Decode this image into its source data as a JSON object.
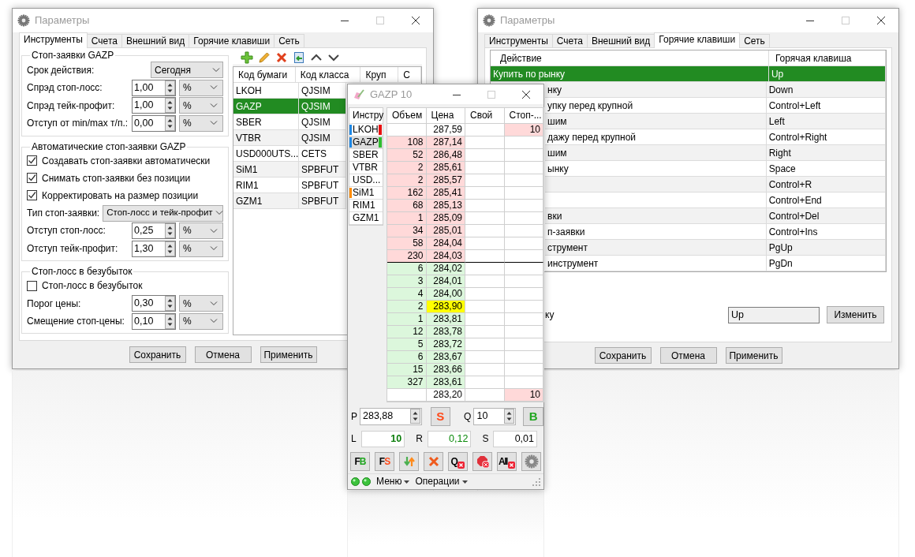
{
  "settings_window": {
    "title": "Параметры",
    "tabs": [
      {
        "label": "Инструменты",
        "selected": true
      },
      {
        "label": "Счета",
        "selected": false
      },
      {
        "label": "Внешний вид",
        "selected": false
      },
      {
        "label": "Горячие клавиши",
        "selected": false
      },
      {
        "label": "Сеть",
        "selected": false
      }
    ],
    "groups": [
      {
        "title": "Стоп-заявки GAZP",
        "rows": [
          {
            "kind": "select",
            "label": "Срок действия:",
            "value": "Сегодня"
          },
          {
            "kind": "spin",
            "label": "Спрэд стоп-лосс:",
            "value": "1,00",
            "unit": "%"
          },
          {
            "kind": "spin",
            "label": "Спрэд тейк-профит:",
            "value": "1,00",
            "unit": "%"
          },
          {
            "kind": "spin",
            "label": "Отступ от min/max т/п.:",
            "value": "0,00",
            "unit": "%"
          }
        ]
      },
      {
        "title": "Автоматические стоп-заявки GAZP",
        "rows": [
          {
            "kind": "check",
            "label": "Создавать стоп-заявки автоматически",
            "checked": true
          },
          {
            "kind": "check",
            "label": "Снимать стоп-заявки без позиции",
            "checked": true
          },
          {
            "kind": "check",
            "label": "Корректировать на размер позиции",
            "checked": true
          },
          {
            "kind": "select",
            "label": "Тип стоп-заявки:",
            "value": "Стоп-лосс и тейк-профит"
          },
          {
            "kind": "spin",
            "label": "Отступ стоп-лосс:",
            "value": "0,25",
            "unit": "%"
          },
          {
            "kind": "spin",
            "label": "Отступ тейк-профит:",
            "value": "1,30",
            "unit": "%"
          }
        ]
      },
      {
        "title": "Стоп-лосс в безубыток",
        "rows": [
          {
            "kind": "check",
            "label": "Стоп-лосс в безубыток",
            "checked": false
          },
          {
            "kind": "spin",
            "label": "Порог цены:",
            "value": "0,30",
            "unit": "%"
          },
          {
            "kind": "spin",
            "label": "Смещение стоп-цены:",
            "value": "0,10",
            "unit": "%"
          }
        ]
      }
    ],
    "table": {
      "columns": [
        "Код бумаги",
        "Код класса",
        "Круп",
        "С"
      ],
      "rows": [
        {
          "cells": [
            "LKOH",
            "QJSIM"
          ],
          "selected": false
        },
        {
          "cells": [
            "GAZP",
            "QJSIM"
          ],
          "selected": true
        },
        {
          "cells": [
            "SBER",
            "QJSIM"
          ],
          "selected": false
        },
        {
          "cells": [
            "VTBR",
            "QJSIM"
          ],
          "selected": false
        },
        {
          "cells": [
            "USD000UTS...",
            "CETS"
          ],
          "selected": false
        },
        {
          "cells": [
            "SiM1",
            "SPBFUT"
          ],
          "selected": false
        },
        {
          "cells": [
            "RIM1",
            "SPBFUT"
          ],
          "selected": false
        },
        {
          "cells": [
            "GZM1",
            "SPBFUT"
          ],
          "selected": false
        }
      ]
    },
    "buttons": [
      "Сохранить",
      "Отмена",
      "Применить"
    ]
  },
  "hotkeys_window": {
    "title": "Параметры",
    "tabs": [
      {
        "label": "Инструменты",
        "selected": false
      },
      {
        "label": "Счета",
        "selected": false
      },
      {
        "label": "Внешний вид",
        "selected": false
      },
      {
        "label": "Горячие клавиши",
        "selected": true
      },
      {
        "label": "Сеть",
        "selected": false
      }
    ],
    "table": {
      "columns": [
        "Действие",
        "Горячая клавиша"
      ],
      "rows": [
        {
          "action": "Купить по рынку",
          "key": "Up",
          "selected": true
        },
        {
          "action": "нку",
          "key": "Down",
          "selected": false
        },
        {
          "action": "упку перед крупной",
          "key": "Control+Left",
          "selected": false
        },
        {
          "action": "шим",
          "key": "Left",
          "selected": false
        },
        {
          "action": "дажу перед крупной",
          "key": "Control+Right",
          "selected": false
        },
        {
          "action": "шим",
          "key": "Right",
          "selected": false
        },
        {
          "action": "ынку",
          "key": "Space",
          "selected": false
        },
        {
          "key": "Control+R",
          "selected": false
        },
        {
          "key": "Control+End",
          "selected": false
        },
        {
          "action": "вки",
          "key": "Control+Del",
          "selected": false
        },
        {
          "action": "п-заявки",
          "key": "Control+Ins",
          "selected": false
        },
        {
          "action": "струмент",
          "key": "PgUp",
          "selected": false
        },
        {
          "action": "инструмент",
          "key": "PgDn",
          "selected": false
        }
      ]
    },
    "hotkey_label": "ку",
    "hotkey_value": "Up",
    "change_button": "Изменить",
    "buttons": [
      "Сохранить",
      "Отмена",
      "Применить"
    ]
  },
  "order_book_window": {
    "title": "GAZP 10",
    "instruments": {
      "header": "Инстру",
      "items": [
        {
          "label": "LKOH",
          "selected": false,
          "color": "#1e88e5",
          "flag": {
            "color": "#e81010"
          }
        },
        {
          "label": "GAZP",
          "selected": true,
          "color": "#1e88e5",
          "flag": {
            "color": "#2ebd2e"
          }
        },
        {
          "label": "SBER",
          "selected": false
        },
        {
          "label": "VTBR",
          "selected": false
        },
        {
          "label": "USD...",
          "selected": false
        },
        {
          "label": "SiM1",
          "selected": false,
          "color": "#ff8c00"
        },
        {
          "label": "RIM1",
          "selected": false
        },
        {
          "label": "GZM1",
          "selected": false
        }
      ]
    },
    "book": {
      "columns": [
        "Объем",
        "Цена",
        "Свой",
        "Стоп-..."
      ],
      "rows": [
        {
          "kind": "plain",
          "price": "287,59",
          "stop": "10",
          "highlighted": false
        },
        {
          "kind": "ask",
          "volume": "108",
          "price": "287,14",
          "highlighted": false
        },
        {
          "kind": "ask",
          "volume": "52",
          "price": "286,48",
          "highlighted": false
        },
        {
          "kind": "ask",
          "volume": "2",
          "price": "285,61",
          "highlighted": false
        },
        {
          "kind": "ask",
          "volume": "2",
          "price": "285,57",
          "highlighted": false
        },
        {
          "kind": "ask",
          "volume": "162",
          "price": "285,41",
          "highlighted": false
        },
        {
          "kind": "ask",
          "volume": "68",
          "price": "285,13",
          "highlighted": false
        },
        {
          "kind": "ask",
          "volume": "1",
          "price": "285,09",
          "highlighted": false
        },
        {
          "kind": "ask",
          "volume": "34",
          "price": "285,01",
          "highlighted": false
        },
        {
          "kind": "ask",
          "volume": "58",
          "price": "284,04",
          "highlighted": false
        },
        {
          "kind": "ask",
          "volume": "230",
          "price": "284,03",
          "highlighted": false
        },
        {
          "kind": "bid",
          "volume": "6",
          "price": "284,02",
          "highlighted": false
        },
        {
          "kind": "bid",
          "volume": "3",
          "price": "284,01",
          "highlighted": false
        },
        {
          "kind": "bid",
          "volume": "4",
          "price": "284,00",
          "highlighted": false
        },
        {
          "kind": "bid",
          "volume": "2",
          "price": "283,90",
          "highlighted": true
        },
        {
          "kind": "bid",
          "volume": "1",
          "price": "283,81",
          "highlighted": false
        },
        {
          "kind": "bid",
          "volume": "12",
          "price": "283,78",
          "highlighted": false
        },
        {
          "kind": "bid",
          "volume": "5",
          "price": "283,72",
          "highlighted": false
        },
        {
          "kind": "bid",
          "volume": "6",
          "price": "283,67",
          "highlighted": false
        },
        {
          "kind": "bid",
          "volume": "15",
          "price": "283,66",
          "highlighted": false
        },
        {
          "kind": "bid",
          "volume": "327",
          "price": "283,61",
          "highlighted": false
        },
        {
          "kind": "plain",
          "price": "283,20",
          "stop": "10",
          "highlighted": false
        }
      ]
    },
    "price_label": "P",
    "price": "283,88",
    "sell": "S",
    "qty_label": "Q",
    "qty": "10",
    "buy": "B",
    "fields": [
      {
        "label": "L",
        "value": "10",
        "color": "#0a7d0a",
        "bold": true
      },
      {
        "label": "R",
        "value": "0,12",
        "color": "#0a8a0a",
        "bold": false
      },
      {
        "label": "S",
        "value": "0,01",
        "color": "#000000",
        "bold": false
      }
    ],
    "tools": [
      {
        "kind": "pair",
        "first": "F",
        "second": "B",
        "color": "#1fa51f"
      },
      {
        "kind": "pair",
        "first": "F",
        "second": "S",
        "color": "#ff4a1a"
      },
      {
        "kind": "swap"
      },
      {
        "kind": "cancel"
      },
      {
        "kind": "letter-x",
        "text": "Q"
      },
      {
        "kind": "stop-x"
      },
      {
        "kind": "letter-x",
        "text": "All"
      },
      {
        "kind": "settings"
      }
    ],
    "menus": [
      "Меню",
      "Операции"
    ]
  }
}
